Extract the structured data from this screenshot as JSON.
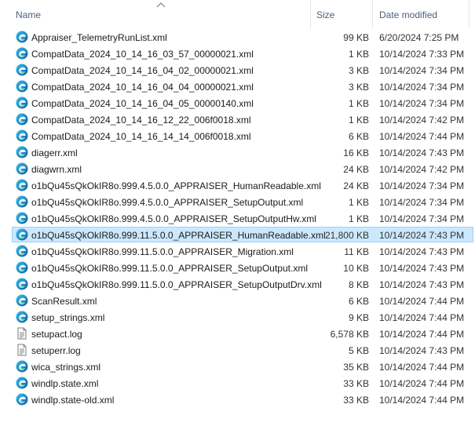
{
  "columns": {
    "name": "Name",
    "size": "Size",
    "date": "Date modified"
  },
  "files": [
    {
      "name": "Appraiser_TelemetryRunList.xml",
      "size": "99 KB",
      "date": "6/20/2024 7:25 PM",
      "icon": "edge-xml-icon"
    },
    {
      "name": "CompatData_2024_10_14_16_03_57_00000021.xml",
      "size": "1 KB",
      "date": "10/14/2024 7:33 PM",
      "icon": "edge-xml-icon"
    },
    {
      "name": "CompatData_2024_10_14_16_04_02_00000021.xml",
      "size": "3 KB",
      "date": "10/14/2024 7:34 PM",
      "icon": "edge-xml-icon"
    },
    {
      "name": "CompatData_2024_10_14_16_04_04_00000021.xml",
      "size": "3 KB",
      "date": "10/14/2024 7:34 PM",
      "icon": "edge-xml-icon"
    },
    {
      "name": "CompatData_2024_10_14_16_04_05_00000140.xml",
      "size": "1 KB",
      "date": "10/14/2024 7:34 PM",
      "icon": "edge-xml-icon"
    },
    {
      "name": "CompatData_2024_10_14_16_12_22_006f0018.xml",
      "size": "1 KB",
      "date": "10/14/2024 7:42 PM",
      "icon": "edge-xml-icon"
    },
    {
      "name": "CompatData_2024_10_14_16_14_14_006f0018.xml",
      "size": "6 KB",
      "date": "10/14/2024 7:44 PM",
      "icon": "edge-xml-icon"
    },
    {
      "name": "diagerr.xml",
      "size": "16 KB",
      "date": "10/14/2024 7:43 PM",
      "icon": "edge-xml-icon"
    },
    {
      "name": "diagwrn.xml",
      "size": "24 KB",
      "date": "10/14/2024 7:42 PM",
      "icon": "edge-xml-icon"
    },
    {
      "name": "o1bQu45sQkOkIR8o.999.4.5.0.0_APPRAISER_HumanReadable.xml",
      "size": "24 KB",
      "date": "10/14/2024 7:34 PM",
      "icon": "edge-xml-icon"
    },
    {
      "name": "o1bQu45sQkOkIR8o.999.4.5.0.0_APPRAISER_SetupOutput.xml",
      "size": "1 KB",
      "date": "10/14/2024 7:34 PM",
      "icon": "edge-xml-icon"
    },
    {
      "name": "o1bQu45sQkOkIR8o.999.4.5.0.0_APPRAISER_SetupOutputHw.xml",
      "size": "1 KB",
      "date": "10/14/2024 7:34 PM",
      "icon": "edge-xml-icon"
    },
    {
      "name": "o1bQu45sQkOkIR8o.999.11.5.0.0_APPRAISER_HumanReadable.xml",
      "size": "21,800 KB",
      "date": "10/14/2024 7:43 PM",
      "icon": "edge-xml-icon",
      "selected": true
    },
    {
      "name": "o1bQu45sQkOkIR8o.999.11.5.0.0_APPRAISER_Migration.xml",
      "size": "11 KB",
      "date": "10/14/2024 7:43 PM",
      "icon": "edge-xml-icon"
    },
    {
      "name": "o1bQu45sQkOkIR8o.999.11.5.0.0_APPRAISER_SetupOutput.xml",
      "size": "10 KB",
      "date": "10/14/2024 7:43 PM",
      "icon": "edge-xml-icon"
    },
    {
      "name": "o1bQu45sQkOkIR8o.999.11.5.0.0_APPRAISER_SetupOutputDrv.xml",
      "size": "8 KB",
      "date": "10/14/2024 7:43 PM",
      "icon": "edge-xml-icon"
    },
    {
      "name": "ScanResult.xml",
      "size": "6 KB",
      "date": "10/14/2024 7:44 PM",
      "icon": "edge-xml-icon"
    },
    {
      "name": "setup_strings.xml",
      "size": "9 KB",
      "date": "10/14/2024 7:44 PM",
      "icon": "edge-xml-icon"
    },
    {
      "name": "setupact.log",
      "size": "6,578 KB",
      "date": "10/14/2024 7:44 PM",
      "icon": "text-file-icon"
    },
    {
      "name": "setuperr.log",
      "size": "5 KB",
      "date": "10/14/2024 7:43 PM",
      "icon": "text-file-icon"
    },
    {
      "name": "wica_strings.xml",
      "size": "35 KB",
      "date": "10/14/2024 7:44 PM",
      "icon": "edge-xml-icon"
    },
    {
      "name": "windlp.state.xml",
      "size": "33 KB",
      "date": "10/14/2024 7:44 PM",
      "icon": "edge-xml-icon"
    },
    {
      "name": "windlp.state-old.xml",
      "size": "33 KB",
      "date": "10/14/2024 7:44 PM",
      "icon": "edge-xml-icon"
    }
  ]
}
